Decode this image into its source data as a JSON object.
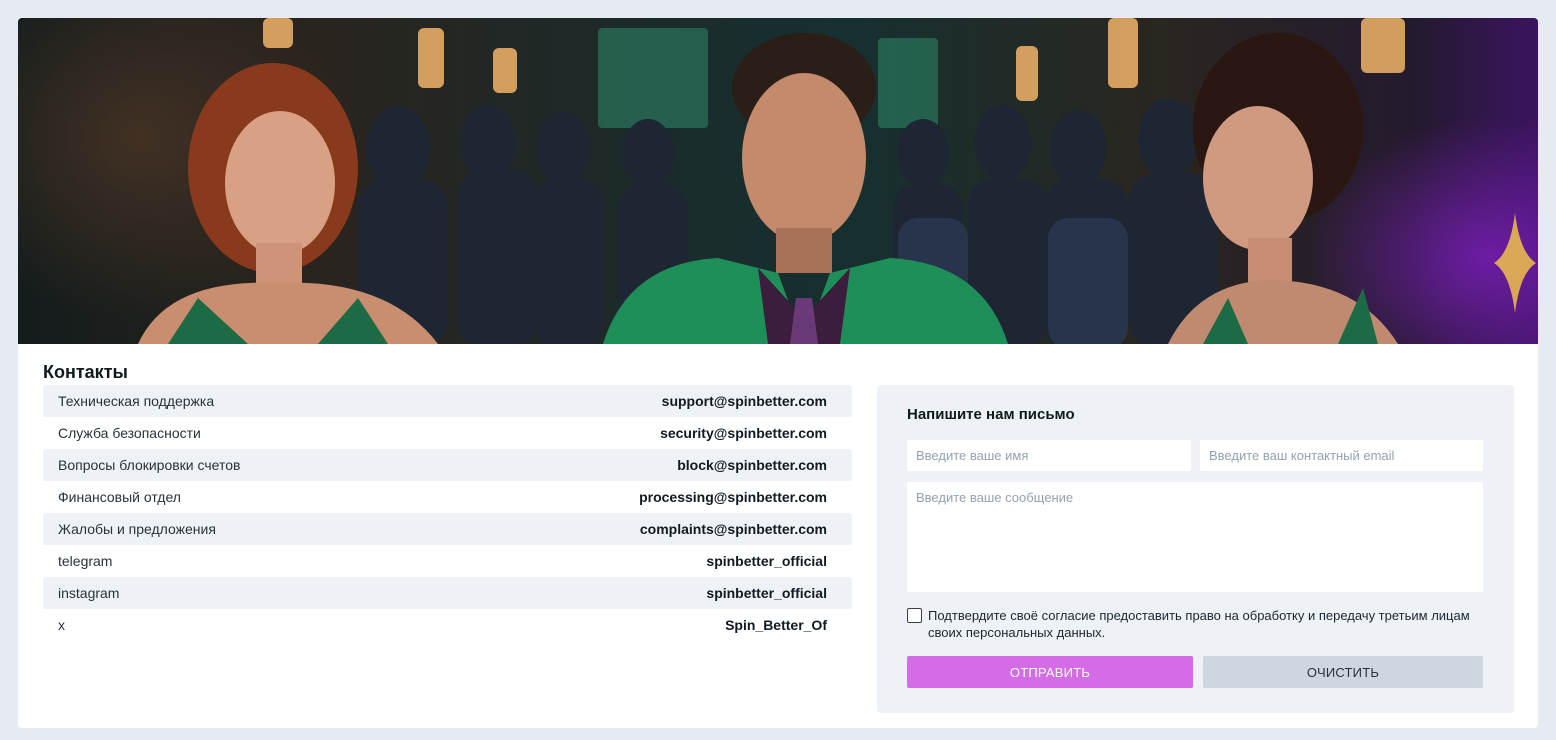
{
  "contacts": {
    "title": "Контакты",
    "rows": [
      {
        "label": "Техническая поддержка",
        "value": "support@spinbetter.com"
      },
      {
        "label": "Служба безопасности",
        "value": "security@spinbetter.com"
      },
      {
        "label": "Вопросы блокировки счетов",
        "value": "block@spinbetter.com"
      },
      {
        "label": "Финансовый отдел",
        "value": "processing@spinbetter.com"
      },
      {
        "label": "Жалобы и предложения",
        "value": "complaints@spinbetter.com"
      },
      {
        "label": "telegram",
        "value": "spinbetter_official"
      },
      {
        "label": "instagram",
        "value": "spinbetter_official"
      },
      {
        "label": "x",
        "value": "Spin_Better_Of"
      }
    ]
  },
  "form": {
    "title": "Напишите нам письмо",
    "name_placeholder": "Введите ваше имя",
    "email_placeholder": "Введите ваш контактный email",
    "message_placeholder": "Введите ваше сообщение",
    "consent_text": "Подтвердите своё согласие предоставить право на обработку и передачу третьим лицам своих персональных данных.",
    "consent_checked": false,
    "submit_label": "ОТПРАВИТЬ",
    "clear_label": "ОЧИСТИТЬ"
  },
  "colors": {
    "submit_bg": "#d36ce6",
    "clear_bg": "#cdd7e1",
    "accent_green": "#1f8f5a",
    "accent_purple": "#6a1fa8"
  }
}
